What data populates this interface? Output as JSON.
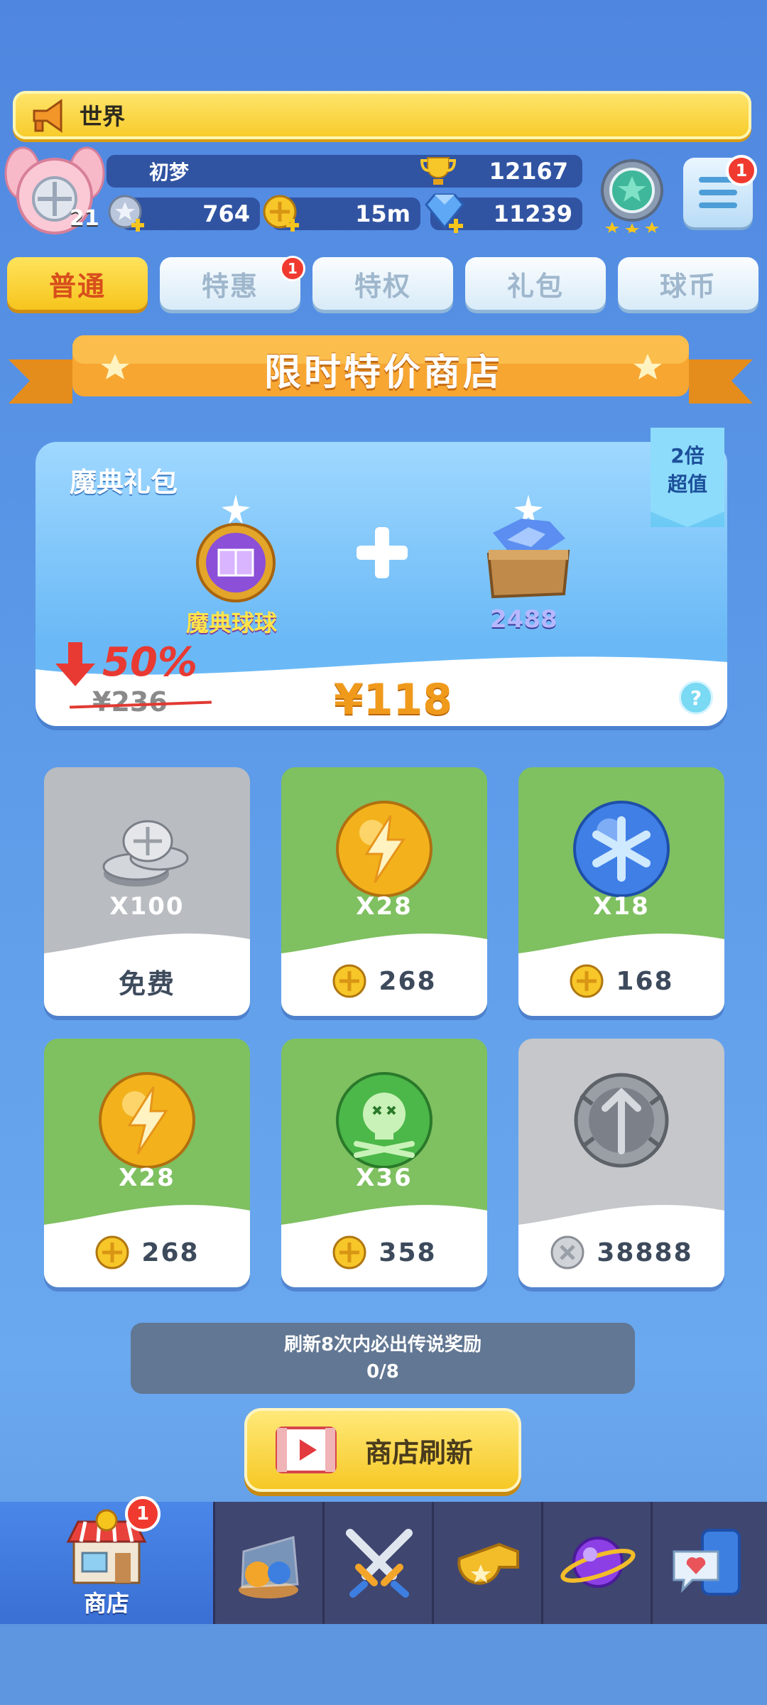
{
  "world_chat": {
    "label": "世界"
  },
  "player": {
    "level": "21",
    "name": "初梦",
    "trophies": "12167",
    "stars": "764",
    "coins": "15m",
    "gems": "11239",
    "menu_badge": "1"
  },
  "tabs": [
    {
      "label": "普通",
      "active": true
    },
    {
      "label": "特惠",
      "badge": "1"
    },
    {
      "label": "特权"
    },
    {
      "label": "礼包"
    },
    {
      "label": "球币"
    }
  ],
  "banner": {
    "title": "限时特价商店"
  },
  "bundle": {
    "title": "魔典礼包",
    "tag_line1": "2倍",
    "tag_line2": "超值",
    "item1_label": "魔典球球",
    "item2_label": "2488",
    "discount": "50%",
    "old_price": "¥236",
    "new_price": "¥118",
    "help": "?"
  },
  "items": [
    {
      "icon": "silver-coins-icon",
      "qty": "X100",
      "price": "免费",
      "free": true,
      "style": "gray"
    },
    {
      "icon": "gold-lightning-ball-icon",
      "qty": "X28",
      "price": "268",
      "style": "green"
    },
    {
      "icon": "ice-snowflake-ball-icon",
      "qty": "X18",
      "price": "168",
      "style": "green"
    },
    {
      "icon": "gold-lightning-ball-icon",
      "qty": "X28",
      "price": "268",
      "style": "green"
    },
    {
      "icon": "green-skull-ball-icon",
      "qty": "X36",
      "price": "358",
      "style": "green"
    },
    {
      "icon": "silver-sword-ball-icon",
      "qty": "",
      "price": "38888",
      "style": "gray",
      "silver_coin": true
    }
  ],
  "refresh_info": {
    "line1": "刷新8次内必出传说奖励",
    "line2": "0/8"
  },
  "refresh_button": {
    "label": "商店刷新"
  },
  "bottom_nav": {
    "shop_label": "商店",
    "shop_badge": "1",
    "items": [
      "balls-jar-icon",
      "crossed-swords-icon",
      "whistle-icon",
      "planet-icon",
      "chat-phone-icon"
    ]
  },
  "colors": {
    "accent_yellow": "#f6c51d",
    "tab_active_text": "#d84e1c",
    "price_orange": "#f09a1c",
    "discount_red": "#e83a32"
  }
}
